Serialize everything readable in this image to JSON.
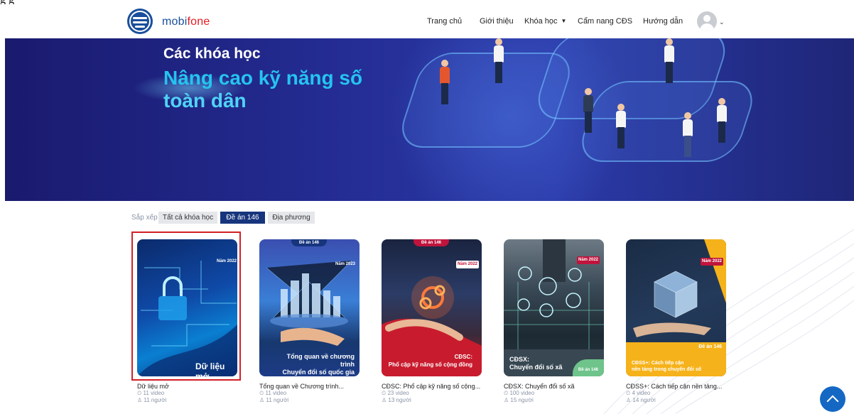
{
  "top_crop_text": "g g",
  "brand": {
    "name_part1": "mobi",
    "name_part2": "fone"
  },
  "nav": {
    "items": [
      {
        "label": "Trang chủ"
      },
      {
        "label": "Giới thiệu"
      },
      {
        "label": "Khóa học"
      },
      {
        "label": "Cẩm nang CĐS"
      },
      {
        "label": "Hướng dẫn"
      }
    ]
  },
  "banner": {
    "subtitle": "Các khóa học",
    "title_line1": "Nâng cao kỹ năng số",
    "title_line2": "toàn dân"
  },
  "sort": {
    "label": "Sắp xếp",
    "tabs": [
      {
        "label": "Tất cả khóa học",
        "active": false
      },
      {
        "label": "Đề án 146",
        "active": true
      },
      {
        "label": "Địa phương",
        "active": false
      }
    ]
  },
  "courses": [
    {
      "title": "Dữ liệu mở",
      "videos": "11 video",
      "people": "11 người",
      "year_tag": "Năm 2022",
      "thumb_text": "Dữ liệu mở"
    },
    {
      "title": "Tổng quan về Chương trình...",
      "videos": "11 video",
      "people": "11 người",
      "top_tag": "Đề án 146",
      "year_tag": "Năm 2023",
      "thumb_text_line1": "Tổng quan về chương trình",
      "thumb_text_line2": "Chuyển đổi số quốc gia"
    },
    {
      "title": "CĐSC: Phổ cập kỹ năng số cộng...",
      "videos": "23 video",
      "people": "13 người",
      "top_tag": "Đề án 146",
      "year_tag": "Năm 2022",
      "thumb_text_line1": "CĐSC:",
      "thumb_text_line2": "Phổ cập kỹ năng số cộng đồng"
    },
    {
      "title": "CĐSX: Chuyển đổi số xã",
      "videos": "100 video",
      "people": "15 người",
      "year_tag": "Năm 2022",
      "thumb_text_line1": "CĐSX:",
      "thumb_text_line2": "Chuyển đổi số xã",
      "corner_tag": "Đề án 146"
    },
    {
      "title": "CĐSS+: Cách tiếp cận nền tảng...",
      "videos": "4 video",
      "people": "14 người",
      "year_tag": "Năm 2022",
      "thumb_text_line1": "CĐSS+: Cách tiếp cận",
      "thumb_text_line2": "nền tảng trong chuyển đổi số",
      "corner_tag": "Đề án 146"
    }
  ],
  "colors": {
    "brand_blue": "#1a4f9c",
    "brand_red": "#e11b22",
    "active_tab": "#17357d",
    "title_cyan": "#25c4f0",
    "highlight_border": "#d21f26",
    "scroll_button": "#1468c4"
  },
  "icons": {
    "video": "clock-icon",
    "people": "person-icon",
    "scroll_top": "chevron-up-icon",
    "dropdown": "caret-down-icon"
  }
}
